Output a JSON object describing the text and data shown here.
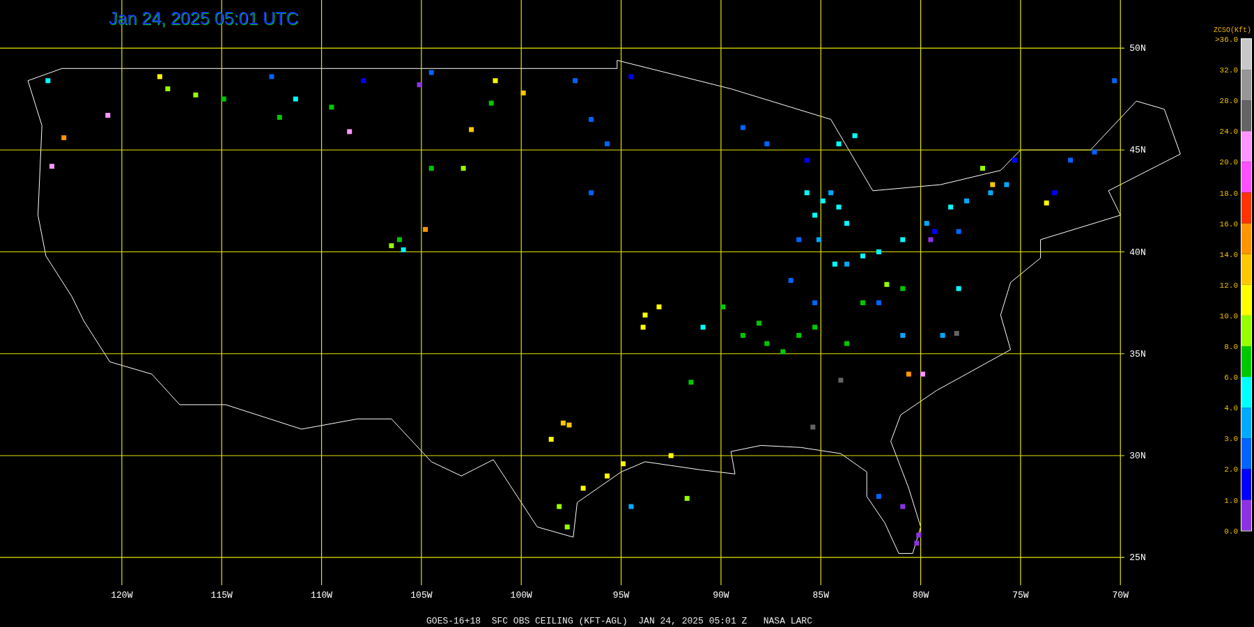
{
  "title": "Jan 24, 2025 05:01 UTC",
  "map": {
    "chart_data": {
      "type": "scatter",
      "grid": true,
      "xlim": [
        -126.1,
        -69.8
      ],
      "ylim": [
        23.64,
        52.36
      ],
      "xticks": [
        {
          "value": -120,
          "label": "120W"
        },
        {
          "value": -115,
          "label": "115W"
        },
        {
          "value": -110,
          "label": "110W"
        },
        {
          "value": -105,
          "label": "105W"
        },
        {
          "value": -100,
          "label": "100W"
        },
        {
          "value": -95,
          "label": "95W"
        },
        {
          "value": -90,
          "label": "90W"
        },
        {
          "value": -85,
          "label": "85W"
        },
        {
          "value": -80,
          "label": "80W"
        },
        {
          "value": -75,
          "label": "75W"
        },
        {
          "value": -70,
          "label": "70W"
        }
      ],
      "yticks": [
        {
          "value": 50,
          "label": "50N"
        },
        {
          "value": 45,
          "label": "45N"
        },
        {
          "value": 40,
          "label": "40N"
        },
        {
          "value": 35,
          "label": "35N"
        },
        {
          "value": 30,
          "label": "30N"
        },
        {
          "value": 25,
          "label": "25N"
        }
      ],
      "series": [
        {
          "color": "#8c32e6",
          "x": [
            -80.9,
            -80.1,
            -80.2,
            -79.5,
            -105.1
          ],
          "values": [
            27.5,
            26.1,
            25.7,
            40.6,
            48.2
          ]
        },
        {
          "color": "#0000ff",
          "x": [
            -107.9,
            -75.3,
            -73.3,
            -85.7,
            -79.3,
            -94.5
          ],
          "values": [
            48.4,
            44.5,
            42.9,
            44.5,
            41.0,
            48.6
          ]
        },
        {
          "color": "#0064ff",
          "x": [
            -86.1,
            -85.3,
            -86.5,
            -82.1,
            -87.7,
            -88.9,
            -96.5,
            -95.7,
            -96.5,
            -78.1,
            -72.5,
            -71.3,
            -112.5,
            -82.1,
            -70.3,
            -97.3,
            -104.5
          ],
          "values": [
            40.6,
            37.5,
            38.6,
            37.5,
            45.3,
            46.1,
            46.5,
            45.3,
            42.9,
            41.0,
            44.5,
            44.9,
            48.6,
            28.0,
            48.4,
            48.4,
            48.8
          ]
        },
        {
          "color": "#00aaff",
          "x": [
            -79.7,
            -77.7,
            -76.5,
            -80.9,
            -78.9,
            -84.5,
            -85.1,
            -83.7,
            -94.5,
            -75.7
          ],
          "values": [
            41.4,
            42.5,
            42.9,
            35.9,
            35.9,
            42.9,
            40.6,
            39.4,
            27.5,
            43.3
          ]
        },
        {
          "color": "#00ffff",
          "x": [
            -85.7,
            -84.9,
            -84.1,
            -85.3,
            -83.7,
            -84.3,
            -82.9,
            -82.1,
            -80.9,
            -78.5,
            -84.1,
            -83.3,
            -78.1,
            -111.3,
            -105.9,
            -123.7,
            -90.9
          ],
          "values": [
            42.9,
            42.5,
            42.2,
            41.8,
            41.4,
            39.4,
            39.8,
            40.0,
            40.6,
            42.2,
            45.3,
            45.7,
            38.2,
            47.5,
            40.1,
            48.4,
            36.3
          ]
        },
        {
          "color": "#00c800",
          "x": [
            -88.9,
            -87.7,
            -86.9,
            -86.1,
            -85.3,
            -88.1,
            -83.7,
            -80.9,
            -82.9,
            -114.9,
            -109.5,
            -112.1,
            -106.1,
            -101.5,
            -104.5,
            -91.5,
            -89.9
          ],
          "values": [
            35.9,
            35.5,
            35.1,
            35.9,
            36.3,
            36.5,
            35.5,
            38.2,
            37.5,
            47.5,
            47.1,
            46.6,
            40.6,
            47.3,
            44.1,
            33.6,
            37.3
          ]
        },
        {
          "color": "#96ff00",
          "x": [
            -117.7,
            -116.3,
            -81.7,
            -106.5,
            -91.7,
            -98.1,
            -97.7,
            -102.9,
            -76.9
          ],
          "values": [
            48.0,
            47.7,
            38.4,
            40.3,
            27.9,
            27.5,
            26.5,
            44.1,
            44.1
          ]
        },
        {
          "color": "#ffff00",
          "x": [
            -118.1,
            -101.3,
            -93.9,
            -93.1,
            -93.8,
            -94.9,
            -95.7,
            -96.9,
            -92.5,
            -98.5,
            -73.7
          ],
          "values": [
            48.6,
            48.4,
            36.3,
            37.3,
            36.9,
            29.6,
            29.0,
            28.4,
            30.0,
            30.8,
            42.4
          ]
        },
        {
          "color": "#ffc800",
          "x": [
            -97.9,
            -97.6,
            -102.5,
            -99.9,
            -76.4
          ],
          "values": [
            31.6,
            31.5,
            46.0,
            47.8,
            43.3
          ]
        },
        {
          "color": "#ff9600",
          "x": [
            -122.9,
            -104.8,
            -80.6
          ],
          "values": [
            45.6,
            41.1,
            34.0
          ]
        },
        {
          "color": "#ff96ff",
          "x": [
            -120.7,
            -123.5,
            -108.6,
            -79.9
          ],
          "values": [
            46.7,
            44.2,
            45.9,
            34.0
          ]
        },
        {
          "color": "#646464",
          "x": [
            -78.2,
            -84.0,
            -85.4
          ],
          "values": [
            36.0,
            33.7,
            31.4
          ]
        }
      ]
    }
  },
  "legend": {
    "title": "ZCSO(Kft)",
    "labels": [
      ">36.0",
      "32.0",
      "28.0",
      "24.0",
      "20.0",
      "18.0",
      "16.0",
      "14.0",
      "12.0",
      "10.0",
      "8.0",
      "6.0",
      "4.0",
      "3.0",
      "2.0",
      "1.0",
      "0.0"
    ],
    "bands": [
      {
        "color": "#c8c8c8"
      },
      {
        "color": "#969696"
      },
      {
        "color": "#646464"
      },
      {
        "color": "#ff96ff"
      },
      {
        "color": "#ff50ff"
      },
      {
        "color": "#ff3200"
      },
      {
        "color": "#ff9600"
      },
      {
        "color": "#ffc800"
      },
      {
        "color": "#ffff00"
      },
      {
        "color": "#96ff00"
      },
      {
        "color": "#00c800"
      },
      {
        "color": "#00ffff"
      },
      {
        "color": "#00aaff"
      },
      {
        "color": "#0064ff"
      },
      {
        "color": "#0000ff"
      },
      {
        "color": "#8c32e6"
      }
    ]
  },
  "caption": "GOES-16+18  SFC OBS CEILING (KFT-AGL)  JAN 24, 2025 05:01 Z   NASA LARC"
}
